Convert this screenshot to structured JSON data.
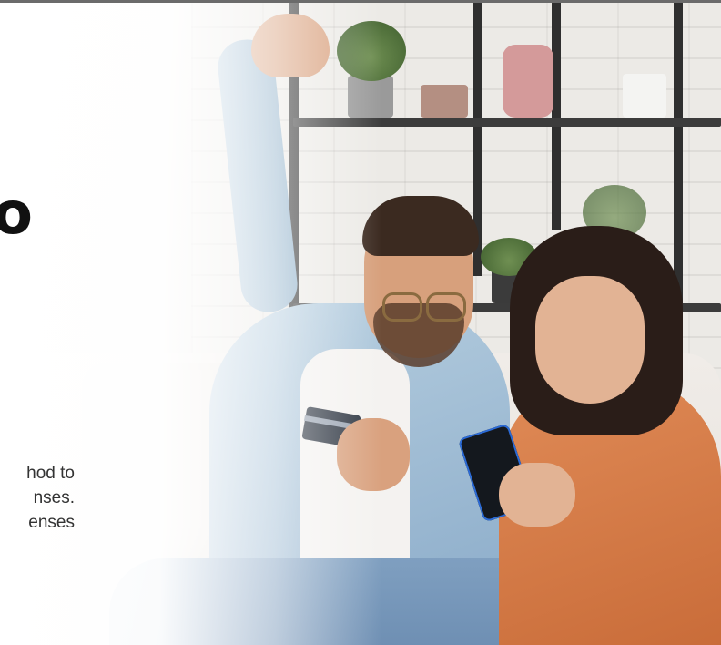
{
  "hero": {
    "heading_fragment": "o",
    "description_lines": [
      "hod to",
      "nses.",
      "enses"
    ]
  },
  "colors": {
    "heading": "#111111",
    "body_text": "#333333",
    "top_border": "#6b6b6b"
  },
  "image": {
    "subject": "couple-celebrating-online-payment"
  }
}
